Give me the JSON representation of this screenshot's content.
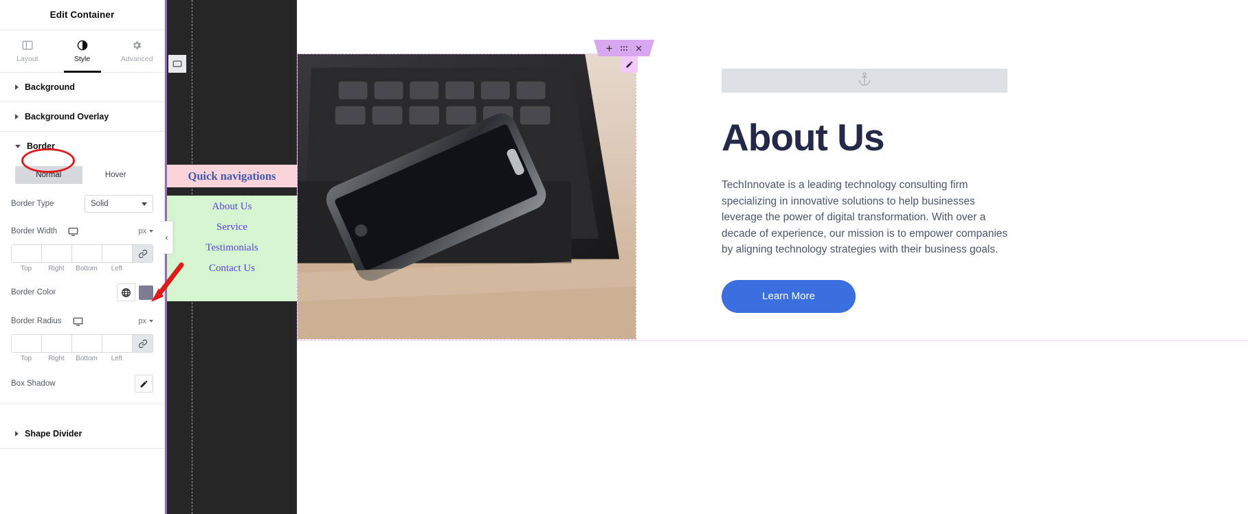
{
  "panel": {
    "title": "Edit Container",
    "tabs": [
      {
        "label": "Layout",
        "icon": "layout-icon",
        "active": false
      },
      {
        "label": "Style",
        "icon": "style-contrast-icon",
        "active": true
      },
      {
        "label": "Advanced",
        "icon": "gear-icon",
        "active": false
      }
    ],
    "sections": [
      {
        "label": "Background",
        "expanded": false
      },
      {
        "label": "Background Overlay",
        "expanded": false
      },
      {
        "label": "Border",
        "expanded": true
      },
      {
        "label": "Shape Divider",
        "expanded": false
      }
    ],
    "border": {
      "state_tabs": [
        {
          "label": "Normal",
          "active": true
        },
        {
          "label": "Hover",
          "active": false
        }
      ],
      "border_type": {
        "label": "Border Type",
        "value": "Solid"
      },
      "border_width": {
        "label": "Border Width",
        "unit": "px",
        "device_icon": "desktop-icon",
        "link_icon": "link-chain-icon",
        "values": [
          "",
          "",
          "",
          ""
        ],
        "side_labels": [
          "Top",
          "Right",
          "Bottom",
          "Left"
        ]
      },
      "border_color": {
        "label": "Border Color",
        "globe_icon": "globe-icon",
        "swatch_color": "#7e7b92"
      },
      "border_radius": {
        "label": "Border Radius",
        "unit": "px",
        "device_icon": "desktop-icon",
        "link_icon": "link-chain-icon",
        "values": [
          "",
          "",
          "",
          ""
        ],
        "side_labels": [
          "Top",
          "Right",
          "Bottom",
          "Left"
        ]
      },
      "box_shadow": {
        "label": "Box Shadow",
        "edit_icon": "pencil-icon"
      }
    }
  },
  "annotations": {
    "circle_target": "Border",
    "arrow_target": "Border Color swatch",
    "color": "#e01b1b"
  },
  "canvas": {
    "container_handle_icon": "container-icon",
    "collapse_toggle_icon": "chevron-left-icon",
    "nav": {
      "title": "Quick navigations",
      "title_bg": "#fad4d8",
      "links_bg": "#d4f5d0",
      "links": [
        "About Us",
        "Service",
        "Testimonials",
        "Contact Us"
      ]
    },
    "image_toolbar": {
      "add_icon": "plus-icon",
      "drag_icon": "drag-handle-icon",
      "close_icon": "close-icon",
      "edit_icon": "pencil-icon"
    },
    "about": {
      "anchor_icon": "anchor-icon",
      "heading": "About Us",
      "paragraph": "TechInnovate is a leading technology consulting firm specializing in innovative solutions to help businesses leverage the power of digital transformation. With over a decade of experience, our mission is to empower companies by aligning technology strategies with their business goals.",
      "button_label": "Learn More",
      "button_color": "#3b6fe0"
    }
  }
}
